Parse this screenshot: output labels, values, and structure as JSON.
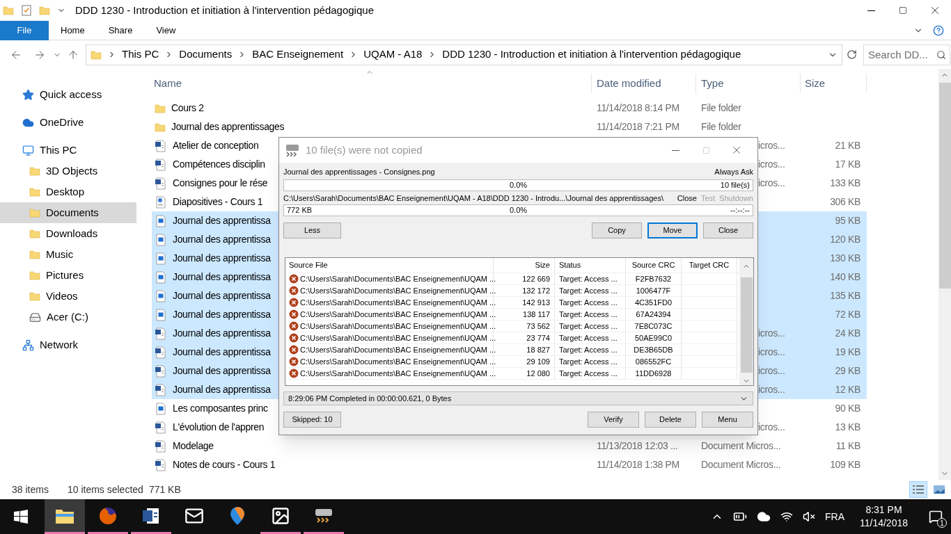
{
  "window": {
    "title": "DDD 1230 - Introduction et initiation à l'intervention pédagogique"
  },
  "ribbon_tabs": [
    {
      "label": "File",
      "selected": true
    },
    {
      "label": "Home",
      "selected": false
    },
    {
      "label": "Share",
      "selected": false
    },
    {
      "label": "View",
      "selected": false
    }
  ],
  "address_bar": {
    "crumbs": [
      "This PC",
      "Documents",
      "BAC Enseignement",
      "UQAM - A18",
      "DDD 1230 - Introduction et initiation à l'intervention pédagogique"
    ]
  },
  "search": {
    "placeholder": "Search DD..."
  },
  "nav": [
    {
      "label": "Quick access",
      "kind": "star",
      "selected": false
    },
    {
      "label": "OneDrive",
      "kind": "cloud",
      "selected": false
    },
    {
      "label": "This PC",
      "kind": "pc",
      "selected": false,
      "children": [
        {
          "label": "3D Objects",
          "kind": "folder",
          "selected": false
        },
        {
          "label": "Desktop",
          "kind": "folder",
          "selected": false
        },
        {
          "label": "Documents",
          "kind": "folder",
          "selected": true
        },
        {
          "label": "Downloads",
          "kind": "folder",
          "selected": false
        },
        {
          "label": "Music",
          "kind": "folder",
          "selected": false
        },
        {
          "label": "Pictures",
          "kind": "folder",
          "selected": false
        },
        {
          "label": "Videos",
          "kind": "folder",
          "selected": false
        },
        {
          "label": "Acer (C:)",
          "kind": "drive",
          "selected": false
        }
      ]
    },
    {
      "label": "Network",
      "kind": "network",
      "selected": false
    }
  ],
  "columns": [
    {
      "label": "Name",
      "sorted": true
    },
    {
      "label": "Date modified",
      "sorted": false
    },
    {
      "label": "Type",
      "sorted": false
    },
    {
      "label": "Size",
      "sorted": false
    }
  ],
  "files": [
    {
      "name": "Cours 2",
      "kind": "folder",
      "date": "11/14/2018 8:14 PM",
      "type": "File folder",
      "selected": false
    },
    {
      "name": "Journal des apprentissages",
      "kind": "folder",
      "date": "11/14/2018 7:21 PM",
      "type": "File folder",
      "selected": false
    },
    {
      "name": "Atelier de conception",
      "kind": "word",
      "type": "icros...",
      "size": "21 KB",
      "selected": false
    },
    {
      "name": "Compétences disciplin",
      "kind": "word",
      "type": "icros...",
      "size": "17 KB",
      "selected": false
    },
    {
      "name": "Consignes pour le rése",
      "kind": "word",
      "type": "icros...",
      "size": "133 KB",
      "selected": false
    },
    {
      "name": "Diapositives - Cours 1",
      "kind": "pdf",
      "size": "306 KB",
      "selected": false
    },
    {
      "name": "Journal des apprentissa",
      "kind": "image",
      "size": "95 KB",
      "selected": true
    },
    {
      "name": "Journal des apprentissa",
      "kind": "image",
      "size": "120 KB",
      "selected": true
    },
    {
      "name": "Journal des apprentissa",
      "kind": "image",
      "size": "130 KB",
      "selected": true
    },
    {
      "name": "Journal des apprentissa",
      "kind": "image",
      "size": "140 KB",
      "selected": true
    },
    {
      "name": "Journal des apprentissa",
      "kind": "image",
      "size": "135 KB",
      "selected": true
    },
    {
      "name": "Journal des apprentissa",
      "kind": "image",
      "size": "72 KB",
      "selected": true
    },
    {
      "name": "Journal des apprentissa",
      "kind": "word",
      "type": "icros...",
      "size": "24 KB",
      "selected": true
    },
    {
      "name": "Journal des apprentissa",
      "kind": "word",
      "type": "icros...",
      "size": "19 KB",
      "selected": true
    },
    {
      "name": "Journal des apprentissa",
      "kind": "word",
      "type": "icros...",
      "size": "29 KB",
      "selected": true
    },
    {
      "name": "Journal des apprentissa",
      "kind": "word",
      "type": "icros...",
      "size": "12 KB",
      "selected": true
    },
    {
      "name": "Les composantes princ",
      "kind": "image",
      "size": "90 KB",
      "selected": false
    },
    {
      "name": "L'évolution de l'appren",
      "kind": "word",
      "type": "icros...",
      "size": "13 KB",
      "selected": false
    },
    {
      "name": "Modelage",
      "kind": "word",
      "date": "11/13/2018 12:03 ...",
      "type": "Document Micros...",
      "size": "11 KB",
      "selected": false
    },
    {
      "name": "Notes de cours - Cours 1",
      "kind": "word",
      "date": "11/14/2018 1:38 PM",
      "type": "Document Micros...",
      "size": "109 KB",
      "selected": false
    }
  ],
  "dialog": {
    "title": "10 file(s) were not copied",
    "current_file": "Journal des apprentissages - Consignes.png",
    "overwrite_mode": "Always Ask",
    "total_progress": {
      "level": 0,
      "percent": "0.0%",
      "count": "10 file(s)"
    },
    "target_path": "C:\\Users\\Sarah\\Documents\\BAC Enseignement\\UQAM - A18\\DDD 1230 - Introdu...\\Journal des apprentissages\\",
    "after_options": [
      {
        "label": "Close",
        "disabled": false
      },
      {
        "label": "Test",
        "disabled": true
      },
      {
        "label": "Shutdown",
        "disabled": true
      }
    ],
    "file_progress": {
      "level": 0,
      "size": "772 KB",
      "percent": "0.0%",
      "time": "--:--:--"
    },
    "less_button": "Less",
    "action_buttons": [
      {
        "label": "Copy",
        "focused": false
      },
      {
        "label": "Move",
        "focused": true
      },
      {
        "label": "Close",
        "focused": false
      }
    ],
    "table": {
      "columns": [
        "Source File",
        "Size",
        "Status",
        "Source CRC",
        "Target CRC"
      ],
      "rows": [
        {
          "source": "C:\\Users\\Sarah\\Documents\\BAC Enseignement\\UQAM ...",
          "size": "122 669",
          "status": "Target: Access ...",
          "source_crc": "F2FB7632"
        },
        {
          "source": "C:\\Users\\Sarah\\Documents\\BAC Enseignement\\UQAM ...",
          "size": "132 172",
          "status": "Target: Access ...",
          "source_crc": "1006477F"
        },
        {
          "source": "C:\\Users\\Sarah\\Documents\\BAC Enseignement\\UQAM ...",
          "size": "142 913",
          "status": "Target: Access ...",
          "source_crc": "4C351FD0"
        },
        {
          "source": "C:\\Users\\Sarah\\Documents\\BAC Enseignement\\UQAM ...",
          "size": "138 117",
          "status": "Target: Access ...",
          "source_crc": "67A24394"
        },
        {
          "source": "C:\\Users\\Sarah\\Documents\\BAC Enseignement\\UQAM ...",
          "size": "73 562",
          "status": "Target: Access ...",
          "source_crc": "7E8C073C"
        },
        {
          "source": "C:\\Users\\Sarah\\Documents\\BAC Enseignement\\UQAM ...",
          "size": "23 774",
          "status": "Target: Access ...",
          "source_crc": "50AE99C0"
        },
        {
          "source": "C:\\Users\\Sarah\\Documents\\BAC Enseignement\\UQAM ...",
          "size": "18 827",
          "status": "Target: Access ...",
          "source_crc": "DE3B65DB"
        },
        {
          "source": "C:\\Users\\Sarah\\Documents\\BAC Enseignement\\UQAM ...",
          "size": "29 109",
          "status": "Target: Access ...",
          "source_crc": "086552FC"
        },
        {
          "source": "C:\\Users\\Sarah\\Documents\\BAC Enseignement\\UQAM ...",
          "size": "12 080",
          "status": "Target: Access ...",
          "source_crc": "11DD6928"
        }
      ]
    },
    "log": "8:29:06 PM Completed in 00:00:00.621, 0 Bytes",
    "skipped": "Skipped: 10",
    "bottom_buttons": [
      "Verify",
      "Delete",
      "Menu"
    ]
  },
  "status_bar": {
    "items": "38 items",
    "selected": "10 items selected",
    "size": "771 KB",
    "views": [
      {
        "kind": "details",
        "selected": true
      },
      {
        "kind": "tiles",
        "selected": false
      }
    ]
  },
  "taskbar": {
    "apps": [
      {
        "kind": "files",
        "active": true,
        "running": true
      },
      {
        "kind": "browser",
        "active": false,
        "running": true
      },
      {
        "kind": "word",
        "active": false,
        "running": true
      },
      {
        "kind": "mail",
        "active": false,
        "running": false
      },
      {
        "kind": "maps",
        "active": false,
        "running": false
      },
      {
        "kind": "photos",
        "active": false,
        "running": true
      },
      {
        "kind": "copier",
        "active": false,
        "running": true
      }
    ],
    "language": "FRA",
    "time": "8:31 PM",
    "date": "11/14/2018",
    "notifications": "1"
  }
}
